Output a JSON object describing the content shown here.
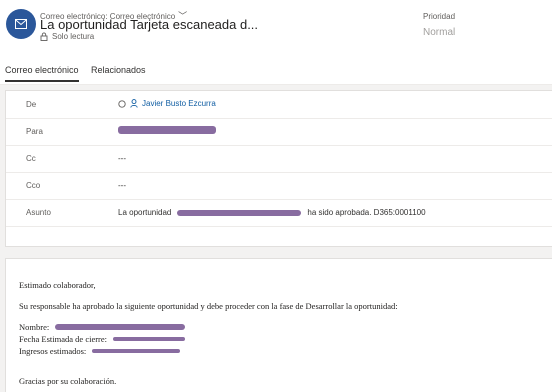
{
  "header": {
    "breadcrumb": "Correo electrónico: Correo electrónico",
    "title": "La oportunidad Tarjeta escaneada d...",
    "readonly": "Solo lectura",
    "priority_label": "Prioridad",
    "priority_value": "Normal",
    "accent_color": "#2b579a"
  },
  "tabs": [
    {
      "label": "Correo electrónico",
      "active": true
    },
    {
      "label": "Relacionados",
      "active": false
    }
  ],
  "fields": {
    "from": {
      "label": "De",
      "value": "Javier Busto Ezcurra"
    },
    "to": {
      "label": "Para"
    },
    "cc": {
      "label": "Cc",
      "value": "---"
    },
    "bcc": {
      "label": "Cco",
      "value": "---"
    },
    "subject": {
      "label": "Asunto",
      "prefix": "La oportunidad",
      "suffix": "ha sido aprobada. D365:0001100"
    }
  },
  "email_body": {
    "greeting": "Estimado colaborador,",
    "paragraph": "Su responsable ha aprobado la siguiente oportunidad y debe proceder con la fase de Desarrollar la oportunidad:",
    "name_label": "Nombre:",
    "close_date_label": "Fecha Estimada de cierre:",
    "revenue_label": "Ingresos estimados:",
    "closing": "Gracias por su colaboración."
  },
  "redaction_color": "#7b5c96"
}
